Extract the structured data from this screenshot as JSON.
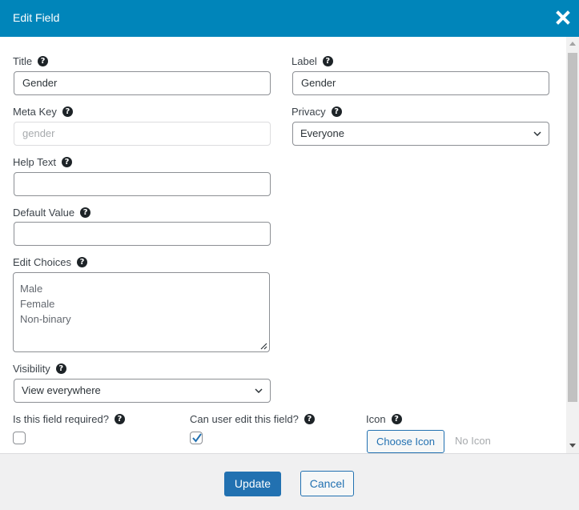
{
  "dialog": {
    "title": "Edit Field",
    "close_icon": "close-icon"
  },
  "fields": {
    "title": {
      "label": "Title",
      "value": "Gender"
    },
    "label": {
      "label": "Label",
      "value": "Gender"
    },
    "meta_key": {
      "label": "Meta Key",
      "placeholder": "gender",
      "disabled": true
    },
    "privacy": {
      "label": "Privacy",
      "selected": "Everyone"
    },
    "help_text": {
      "label": "Help Text",
      "value": ""
    },
    "default_value": {
      "label": "Default Value",
      "value": ""
    },
    "edit_choices": {
      "label": "Edit Choices",
      "choices": [
        "Male",
        "Female",
        "Non-binary"
      ]
    },
    "visibility": {
      "label": "Visibility",
      "selected": "View everywhere"
    },
    "required": {
      "label": "Is this field required?",
      "checked": false
    },
    "user_editable": {
      "label": "Can user edit this field?",
      "checked": true
    },
    "icon": {
      "label": "Icon",
      "button_label": "Choose Icon",
      "status": "No Icon"
    }
  },
  "help_icon_glyph": "?",
  "footer": {
    "update_label": "Update",
    "cancel_label": "Cancel"
  },
  "colors": {
    "header": "#0085ba",
    "primary": "#2271b1",
    "footer_bg": "#f0f0f1"
  }
}
